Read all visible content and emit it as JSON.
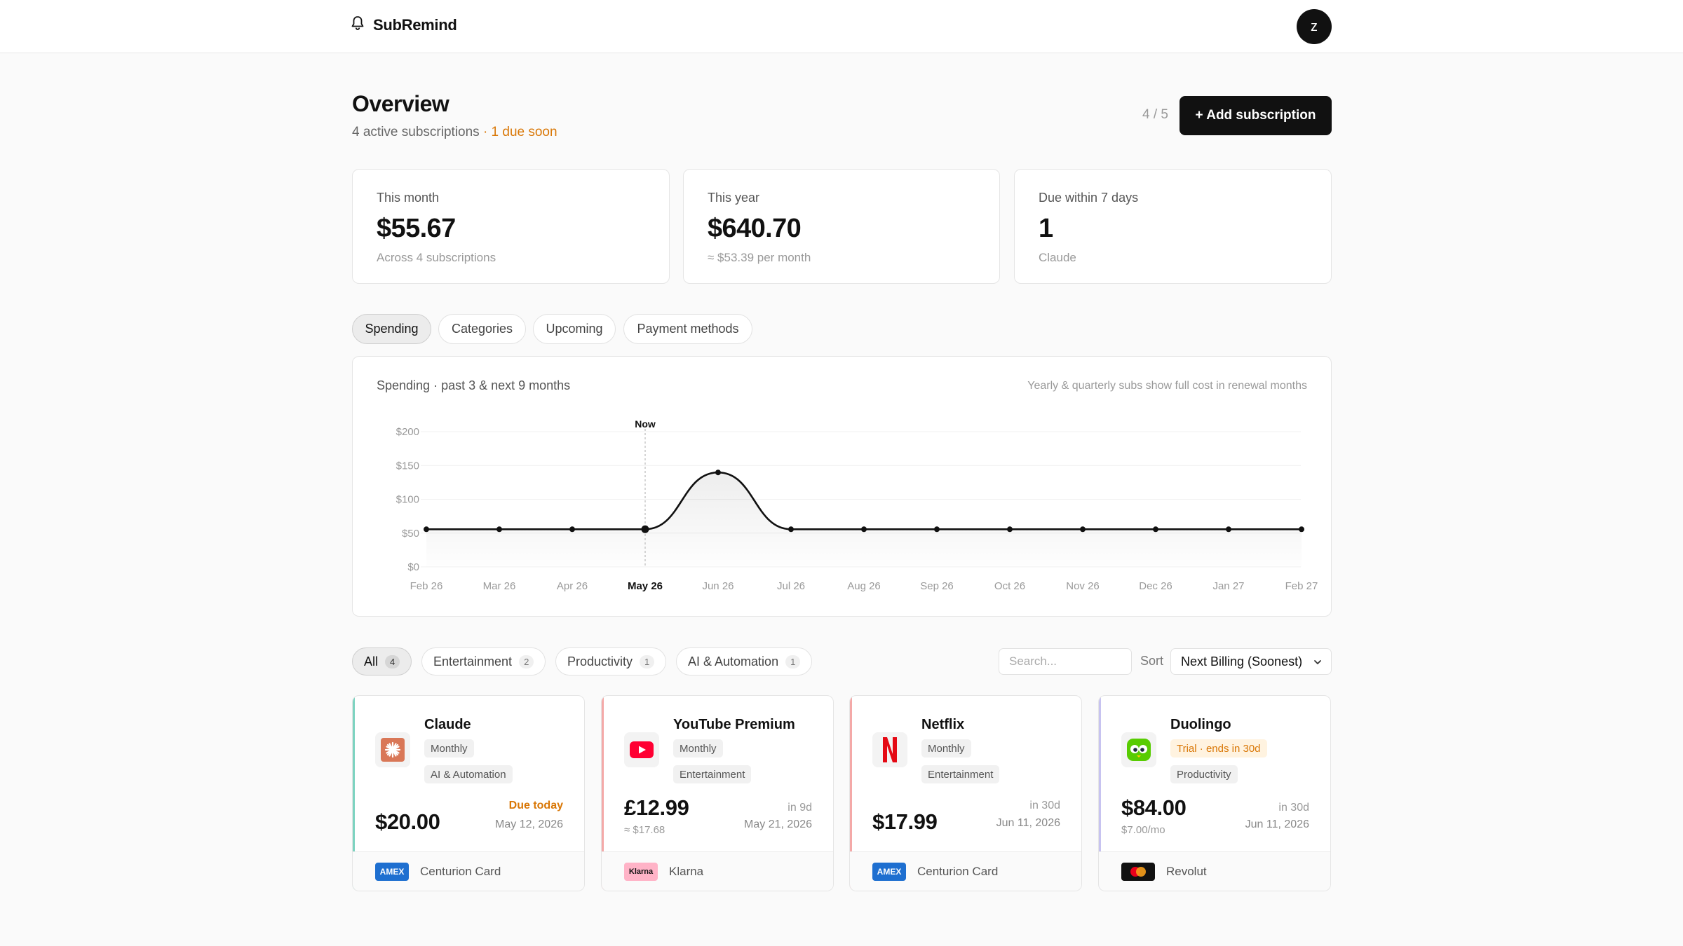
{
  "header": {
    "brand": "SubRemind",
    "avatar_letter": "z"
  },
  "overview": {
    "title": "Overview",
    "active_text": "4 active subscriptions",
    "due_soon_text": "· 1 due soon",
    "counter": "4 / 5",
    "add_button": "+ Add subscription"
  },
  "stats": [
    {
      "label": "This month",
      "value": "$55.67",
      "sub": "Across 4 subscriptions"
    },
    {
      "label": "This year",
      "value": "$640.70",
      "sub": "≈ $53.39 per month"
    },
    {
      "label": "Due within 7 days",
      "value": "1",
      "sub": "Claude"
    }
  ],
  "tabs": [
    {
      "label": "Spending",
      "active": true
    },
    {
      "label": "Categories",
      "active": false
    },
    {
      "label": "Upcoming",
      "active": false
    },
    {
      "label": "Payment methods",
      "active": false
    }
  ],
  "chart_header": {
    "title": "Spending · past 3 & next 9 months",
    "note": "Yearly & quarterly subs show full cost in renewal months"
  },
  "chart_data": {
    "type": "area",
    "categories": [
      "Feb 26",
      "Mar 26",
      "Apr 26",
      "May 26",
      "Jun 26",
      "Jul 26",
      "Aug 26",
      "Sep 26",
      "Oct 26",
      "Nov 26",
      "Dec 26",
      "Jan 27",
      "Feb 27"
    ],
    "values": [
      55.67,
      55.67,
      55.67,
      55.67,
      139.67,
      55.67,
      55.67,
      55.67,
      55.67,
      55.67,
      55.67,
      55.67,
      55.67
    ],
    "y_ticks": [
      "$200",
      "$150",
      "$100",
      "$50",
      "$0"
    ],
    "ylim": [
      0,
      200
    ],
    "now_index": 3,
    "now_label": "Now",
    "grid": true
  },
  "filters": [
    {
      "label": "All",
      "count": "4",
      "active": true
    },
    {
      "label": "Entertainment",
      "count": "2",
      "active": false
    },
    {
      "label": "Productivity",
      "count": "1",
      "active": false
    },
    {
      "label": "AI & Automation",
      "count": "1",
      "active": false
    }
  ],
  "search": {
    "placeholder": "Search..."
  },
  "sort": {
    "label": "Sort",
    "value": "Next Billing (Soonest)"
  },
  "subscriptions": [
    {
      "name": "Claude",
      "billing": "Monthly",
      "category": "AI & Automation",
      "price": "$20.00",
      "price_sub": "",
      "due": "Due today",
      "date": "May 12, 2026",
      "payment": "Centurion Card",
      "payment_badge": "AMEX",
      "accent": "#7dd3c0",
      "icon": "claude-icon"
    },
    {
      "name": "YouTube Premium",
      "billing": "Monthly",
      "category": "Entertainment",
      "price": "£12.99",
      "price_sub": "≈ $17.68",
      "due": "in 9d",
      "date": "May 21, 2026",
      "payment": "Klarna",
      "payment_badge": "Klarna",
      "accent": "#f4a9a8",
      "icon": "youtube-icon"
    },
    {
      "name": "Netflix",
      "billing": "Monthly",
      "category": "Entertainment",
      "price": "$17.99",
      "price_sub": "",
      "due": "in 30d",
      "date": "Jun 11, 2026",
      "payment": "Centurion Card",
      "payment_badge": "AMEX",
      "accent": "#f4a9a8",
      "icon": "netflix-icon"
    },
    {
      "name": "Duolingo",
      "billing": "Trial · ends in 30d",
      "category": "Productivity",
      "price": "$84.00",
      "price_sub": "$7.00/mo",
      "due": "in 30d",
      "date": "Jun 11, 2026",
      "payment": "Revolut",
      "payment_badge": "",
      "accent": "#c7c3f0",
      "icon": "duolingo-icon"
    }
  ]
}
